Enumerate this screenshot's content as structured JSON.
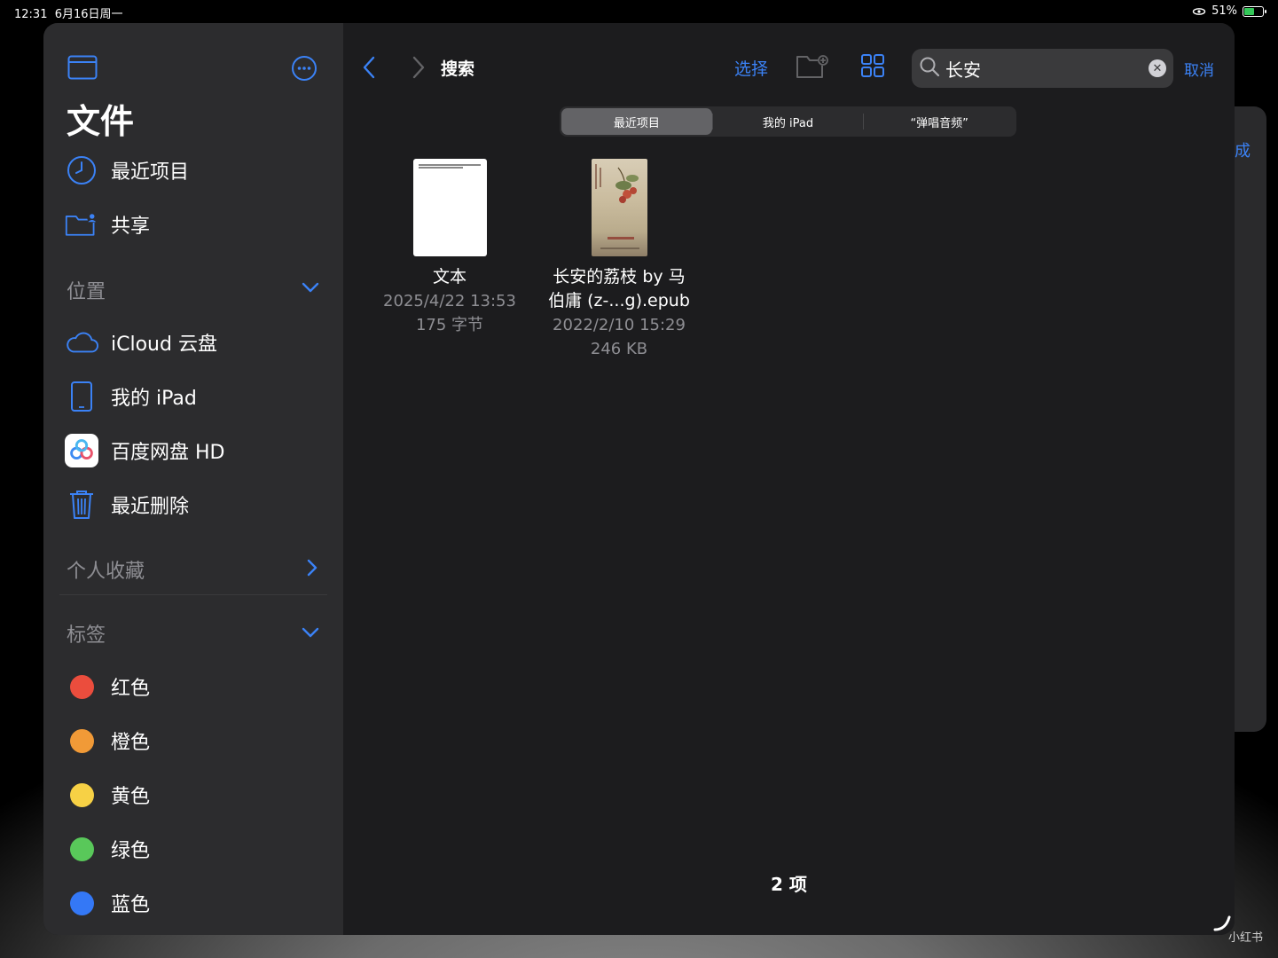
{
  "status_bar": {
    "time": "12:31",
    "date": "6月16日周一",
    "battery": "51%",
    "battery_level": 0.51
  },
  "back_window": {
    "peek_text": "成"
  },
  "sidebar": {
    "title": "文件",
    "top_items": [
      {
        "label": "最近项目",
        "icon": "clock-icon"
      },
      {
        "label": "共享",
        "icon": "shared-folder-icon"
      }
    ],
    "sections": {
      "locations": {
        "label": "位置",
        "items": [
          {
            "label": "iCloud 云盘",
            "icon": "cloud-icon"
          },
          {
            "label": "我的 iPad",
            "icon": "ipad-icon"
          },
          {
            "label": "百度网盘 HD",
            "icon": "baidu-pan-icon"
          },
          {
            "label": "最近删除",
            "icon": "trash-icon"
          }
        ]
      },
      "favorites": {
        "label": "个人收藏"
      },
      "tags": {
        "label": "标签",
        "items": [
          {
            "label": "红色",
            "color": "#eb4d3d"
          },
          {
            "label": "橙色",
            "color": "#f19a37"
          },
          {
            "label": "黄色",
            "color": "#f7d145"
          },
          {
            "label": "绿色",
            "color": "#59c85a"
          },
          {
            "label": "蓝色",
            "color": "#3478f6"
          }
        ]
      }
    }
  },
  "toolbar": {
    "title": "搜索",
    "select_label": "选择",
    "cancel_label": "取消"
  },
  "search": {
    "value": "长安"
  },
  "scopes": [
    {
      "label": "最近项目",
      "active": true
    },
    {
      "label": "我的 iPad",
      "active": false
    },
    {
      "label": "“弹唱音频”",
      "active": false
    }
  ],
  "files": [
    {
      "name_lines": [
        "文本"
      ],
      "date": "2025/4/22 13:53",
      "size": "175 字节",
      "type": "text"
    },
    {
      "name_lines": [
        "长安的荔枝 by 马",
        "伯庸 (z-...g).epub"
      ],
      "date": "2022/2/10 15:29",
      "size": "246 KB",
      "type": "epub"
    }
  ],
  "item_count": "2 项",
  "watermark": "小红书",
  "colors": {
    "accent": "#3b82f6",
    "sidebar_bg": "#2c2c2e",
    "main_bg": "#1c1c1e"
  }
}
